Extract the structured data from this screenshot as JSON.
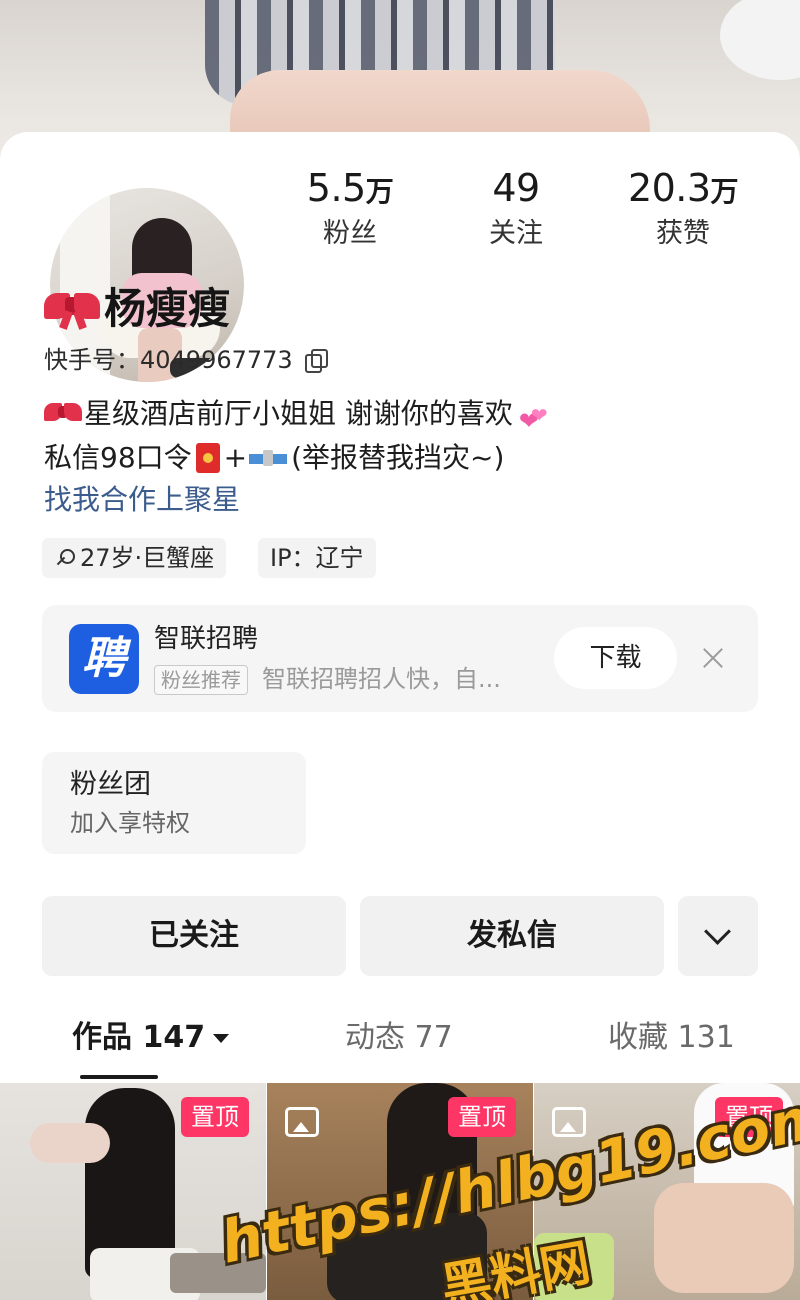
{
  "profile": {
    "name": "杨瘦瘦",
    "id_label": "快手号：",
    "id_value": "4049967773",
    "bio_line1": "星级酒店前厅小姐姐 谢谢你的喜欢",
    "bio_line2_a": "私信98口令",
    "bio_line2_plus": "+",
    "bio_line2_b": "(举报替我挡灾~)",
    "link": "找我合作上聚星",
    "tags": [
      "27岁·巨蟹座",
      "IP：辽宁"
    ]
  },
  "stats": [
    {
      "num": "5.5",
      "unit": "万",
      "label": "粉丝"
    },
    {
      "num": "49",
      "unit": "",
      "label": "关注"
    },
    {
      "num": "20.3",
      "unit": "万",
      "label": "获赞"
    }
  ],
  "ad": {
    "logo_text": "聘",
    "title": "智联招聘",
    "tag": "粉丝推荐",
    "desc": "智联招聘招人快，自...",
    "button": "下载"
  },
  "fan_club": {
    "title": "粉丝团",
    "subtitle": "加入享特权"
  },
  "actions": {
    "follow": "已关注",
    "message": "发私信"
  },
  "tabs": [
    {
      "label": "作品 147",
      "active": true
    },
    {
      "label": "动态 77",
      "active": false
    },
    {
      "label": "收藏 131",
      "active": false
    }
  ],
  "thumbnails": [
    {
      "pin": "置顶"
    },
    {
      "pin": "置顶"
    },
    {
      "pin": "置顶"
    }
  ],
  "watermark": {
    "url": "https://hlbg19.com",
    "name": "黑料网"
  },
  "colors": {
    "pin": "#fe3666",
    "link": "#3b5c8c",
    "ad_logo": "#1d5fe0",
    "watermark": "#f3b11f"
  }
}
